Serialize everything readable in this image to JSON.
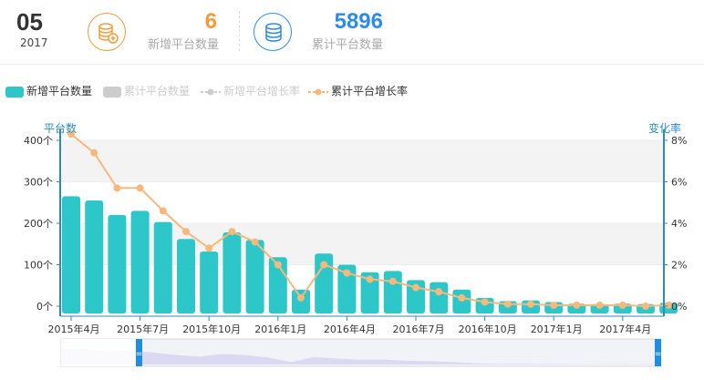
{
  "header": {
    "date_day": "05",
    "date_year": "2017",
    "new_platforms": {
      "value": "6",
      "label": "新增平台数量",
      "color": "#f39c3c",
      "icon": "database-plus-icon"
    },
    "total_platforms": {
      "value": "5896",
      "label": "累计平台数量",
      "color": "#2d8ce8",
      "icon": "database-icon"
    }
  },
  "legend": [
    {
      "name": "新增平台数量",
      "color": "#2ec7c9",
      "active": true
    },
    {
      "name": "累计平台数量",
      "color": "#cccccc",
      "active": false
    },
    {
      "name": "新增平台增长率",
      "color": "#cccccc",
      "active": false
    },
    {
      "name": "累计平台增长率",
      "color": "#f7b87c",
      "active": true
    }
  ],
  "chart_data": {
    "type": "bar",
    "left_axis_title": "平台数",
    "right_axis_title": "变化率",
    "left_ticks": [
      "0个",
      "100个",
      "200个",
      "300个",
      "400个"
    ],
    "right_ticks": [
      "0%",
      "2%",
      "4%",
      "6%",
      "8%"
    ],
    "ylim_left": [
      0,
      400
    ],
    "ylim_right": [
      0,
      8
    ],
    "x_tick_labels": [
      "2015年4月",
      "2015年7月",
      "2015年10月",
      "2016年1月",
      "2016年4月",
      "2016年7月",
      "2016年10月",
      "2017年1月",
      "2017年4月"
    ],
    "grid_bands": true,
    "series": [
      {
        "name": "新增平台数量",
        "kind": "bar",
        "axis": "left",
        "color": "#2ec7c9",
        "values": [
          265,
          255,
          220,
          230,
          203,
          162,
          132,
          178,
          160,
          118,
          40,
          127,
          100,
          82,
          85,
          63,
          58,
          40,
          20,
          12,
          14,
          10,
          6,
          5,
          6,
          5,
          8
        ]
      },
      {
        "name": "累计平台增长率",
        "kind": "line",
        "axis": "right",
        "color": "#f7b87c",
        "values": [
          8.3,
          7.4,
          5.7,
          5.7,
          4.6,
          3.6,
          2.8,
          3.6,
          3.1,
          2.0,
          0.4,
          2.0,
          1.6,
          1.3,
          1.2,
          0.9,
          0.7,
          0.4,
          0.2,
          0.1,
          0.1,
          0.05,
          0.05,
          0.05,
          0.05,
          0.0,
          0.05
        ]
      }
    ]
  },
  "datazoom": {
    "start_handle": "=",
    "end_handle": "="
  }
}
